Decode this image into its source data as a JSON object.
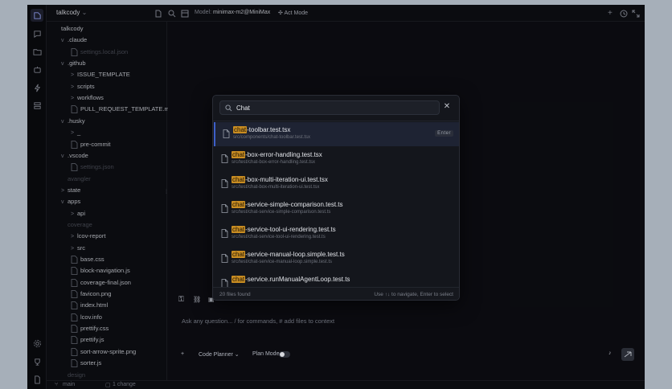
{
  "topbar": {
    "project": "talkcody",
    "model_label": "Model:",
    "model_value": "minimax-m2@MiniMax",
    "mode_label": "Act Mode"
  },
  "tree": [
    {
      "label": "talkcody",
      "depth": 0,
      "chevron": "",
      "kind": "folder"
    },
    {
      "label": ".claude",
      "depth": 1,
      "chevron": "v",
      "kind": "folder"
    },
    {
      "label": "settings.local.json",
      "depth": 2,
      "chevron": "",
      "kind": "file",
      "dim": true
    },
    {
      "label": ".github",
      "depth": 1,
      "chevron": "v",
      "kind": "folder"
    },
    {
      "label": "ISSUE_TEMPLATE",
      "depth": 2,
      "chevron": ">",
      "kind": "folder"
    },
    {
      "label": "scripts",
      "depth": 2,
      "chevron": ">",
      "kind": "folder"
    },
    {
      "label": "workflows",
      "depth": 2,
      "chevron": ">",
      "kind": "folder"
    },
    {
      "label": "PULL_REQUEST_TEMPLATE.md",
      "depth": 2,
      "chevron": "",
      "kind": "file"
    },
    {
      "label": ".husky",
      "depth": 1,
      "chevron": "v",
      "kind": "folder"
    },
    {
      "label": "_",
      "depth": 2,
      "chevron": ">",
      "kind": "folder"
    },
    {
      "label": "pre-commit",
      "depth": 2,
      "chevron": "",
      "kind": "file"
    },
    {
      "label": ".vscode",
      "depth": 1,
      "chevron": "v",
      "kind": "folder"
    },
    {
      "label": "settings.json",
      "depth": 2,
      "chevron": "",
      "kind": "file",
      "dim": true
    },
    {
      "label": "avangler",
      "depth": 1,
      "chevron": "",
      "kind": "folder",
      "dim": true
    },
    {
      "label": "state",
      "depth": 1,
      "chevron": ">",
      "kind": "folder"
    },
    {
      "label": "apps",
      "depth": 1,
      "chevron": "v",
      "kind": "folder"
    },
    {
      "label": "api",
      "depth": 2,
      "chevron": ">",
      "kind": "folder"
    },
    {
      "label": "coverage",
      "depth": 1,
      "chevron": "",
      "kind": "folder",
      "dim": true
    },
    {
      "label": "lcov-report",
      "depth": 2,
      "chevron": ">",
      "kind": "folder"
    },
    {
      "label": "src",
      "depth": 2,
      "chevron": ">",
      "kind": "folder"
    },
    {
      "label": "base.css",
      "depth": 2,
      "chevron": "",
      "kind": "file"
    },
    {
      "label": "block-navigation.js",
      "depth": 2,
      "chevron": "",
      "kind": "file"
    },
    {
      "label": "coverage-final.json",
      "depth": 2,
      "chevron": "",
      "kind": "file"
    },
    {
      "label": "favicon.png",
      "depth": 2,
      "chevron": "",
      "kind": "file"
    },
    {
      "label": "index.html",
      "depth": 2,
      "chevron": "",
      "kind": "file"
    },
    {
      "label": "lcov.info",
      "depth": 2,
      "chevron": "",
      "kind": "file"
    },
    {
      "label": "prettify.css",
      "depth": 2,
      "chevron": "",
      "kind": "file"
    },
    {
      "label": "prettify.js",
      "depth": 2,
      "chevron": "",
      "kind": "file"
    },
    {
      "label": "sort-arrow-sprite.png",
      "depth": 2,
      "chevron": "",
      "kind": "file"
    },
    {
      "label": "sorter.js",
      "depth": 2,
      "chevron": "",
      "kind": "file"
    },
    {
      "label": "design",
      "depth": 1,
      "chevron": "",
      "kind": "folder",
      "dim": true
    }
  ],
  "palette": {
    "query": "Chat",
    "results": [
      {
        "highlight": "chat",
        "rest": "-toolbar.test.tsx",
        "path": "src/components/chat-toolbar.test.tsx",
        "selected": true
      },
      {
        "highlight": "chat",
        "rest": "-box-error-handling.test.tsx",
        "path": "src/test/chat-box-error-handling.test.tsx"
      },
      {
        "highlight": "chat",
        "rest": "-box-multi-iteration-ui.test.tsx",
        "path": "src/test/chat-box-multi-iteration-ui.test.tsx"
      },
      {
        "highlight": "chat",
        "rest": "-service-simple-comparison.test.ts",
        "path": "src/test/chat-service-simple-comparison.test.ts"
      },
      {
        "highlight": "chat",
        "rest": "-service-tool-ui-rendering.test.ts",
        "path": "src/test/chat-service-tool-ui-rendering.test.ts"
      },
      {
        "highlight": "chat",
        "rest": "-service-manual-loop.simple.test.ts",
        "path": "src/test/chat-service-manual-loop.simple.test.ts"
      },
      {
        "highlight": "chat",
        "rest": "-service.runManualAgentLoop.test.ts",
        "path": ""
      }
    ],
    "enter_badge": "Enter",
    "footer_count": "20 files found",
    "footer_hint": "Use ↑↓ to navigate, Enter to select"
  },
  "chat": {
    "placeholder": "Ask any question... / for commands, # add files to context",
    "agent_label": "Code Planner",
    "plan_mode_label": "Plan Mode",
    "plan_mode_on": false
  },
  "statusbar": {
    "branch": "main",
    "changes": "1 change"
  },
  "colors": {
    "highlight": "#c98d22",
    "selection": "#1e2333",
    "background": "#0c0d11"
  }
}
